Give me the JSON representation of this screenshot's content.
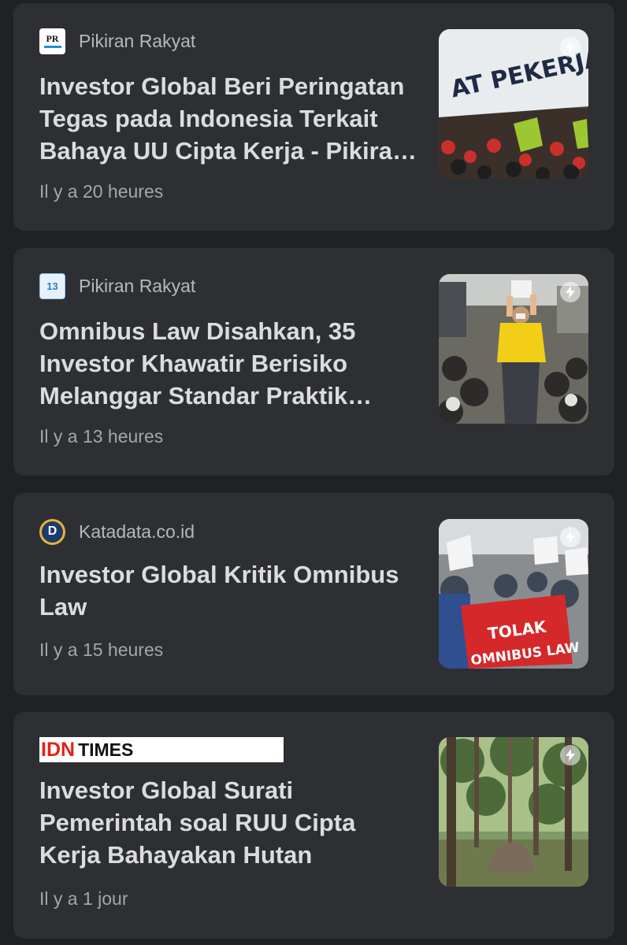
{
  "articles": [
    {
      "source": "Pikiran Rakyat",
      "source_logo": "pr-logo",
      "logo_text": "PR",
      "title": "Investor Global Beri Peringatan Tegas pada Indonesia Terkait Bahaya UU Cipta Kerja - Pikiran Rakyat",
      "time": "Il y a 20 heures",
      "thumb_text": "AT PEKERJA"
    },
    {
      "source": "Pikiran Rakyat",
      "source_logo": "pr-logo-alt",
      "logo_text": "13",
      "title": "Omnibus Law Disahkan, 35 Investor Khawatir Berisiko Melanggar Standar Praktik Bisnis",
      "time": "Il y a 13 heures"
    },
    {
      "source": "Katadata.co.id",
      "source_logo": "katadata-logo",
      "logo_text": "D",
      "title": "Investor Global Kritik Omnibus Law",
      "time": "Il y a 15 heures",
      "thumb_text_1": "TOLAK",
      "thumb_text_2": "OMNIBUS LAW"
    },
    {
      "source_logo": "idn-times-logo",
      "logo_text_1": "IDN",
      "logo_text_2": "TIMES",
      "title": "Investor Global Surati Pemerintah soal RUU Cipta Kerja Bahayakan Hutan",
      "time": "Il y a 1 jour"
    }
  ],
  "colors": {
    "background": "#202124",
    "card": "#2e2f33",
    "title": "#dadce0",
    "meta": "#b6b8bc",
    "idn_red": "#e2231a"
  }
}
